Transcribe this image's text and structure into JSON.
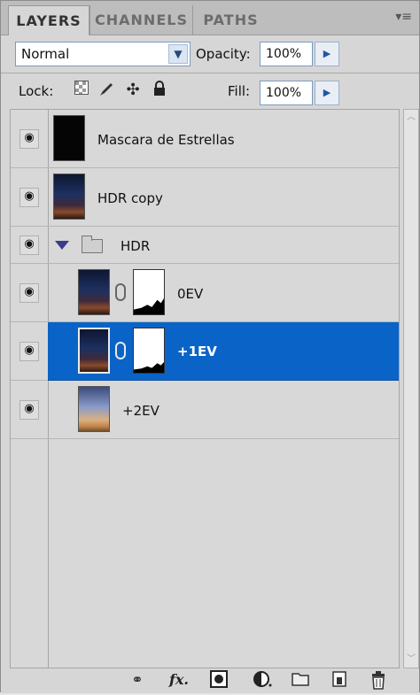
{
  "tabs": [
    {
      "label": "LAYERS",
      "active": true
    },
    {
      "label": "CHANNELS",
      "active": false
    },
    {
      "label": "PATHS",
      "active": false
    }
  ],
  "menu_icon": "panel-menu-icon",
  "blend_mode": "Normal",
  "opacity_label": "Opacity:",
  "opacity_value": "100%",
  "lock_label": "Lock:",
  "lock_icons": [
    "lock-transparent-pixels-icon",
    "lock-image-pixels-icon",
    "lock-position-icon",
    "lock-all-icon"
  ],
  "fill_label": "Fill:",
  "fill_value": "100%",
  "layers": [
    {
      "name": "Mascara de Estrellas",
      "thumb": "black",
      "visible": true
    },
    {
      "name": "HDR copy",
      "thumb": "night",
      "visible": true
    },
    {
      "name": "HDR",
      "type": "group",
      "expanded": true,
      "visible": true
    },
    {
      "name": "0EV",
      "thumb": "night",
      "mask": true,
      "visible": true
    },
    {
      "name": "+1EV",
      "thumb": "night",
      "mask": true,
      "selected": true,
      "visible": true
    },
    {
      "name": "+2EV",
      "thumb": "bright",
      "visible": true
    }
  ],
  "footer_icons": [
    "link-layers-icon",
    "fx-icon",
    "add-mask-icon",
    "adjustment-layer-icon",
    "new-group-icon",
    "new-layer-icon",
    "trash-icon"
  ],
  "colors": {
    "selection": "#0a64c7",
    "panel_bg": "#d6d6d6"
  }
}
